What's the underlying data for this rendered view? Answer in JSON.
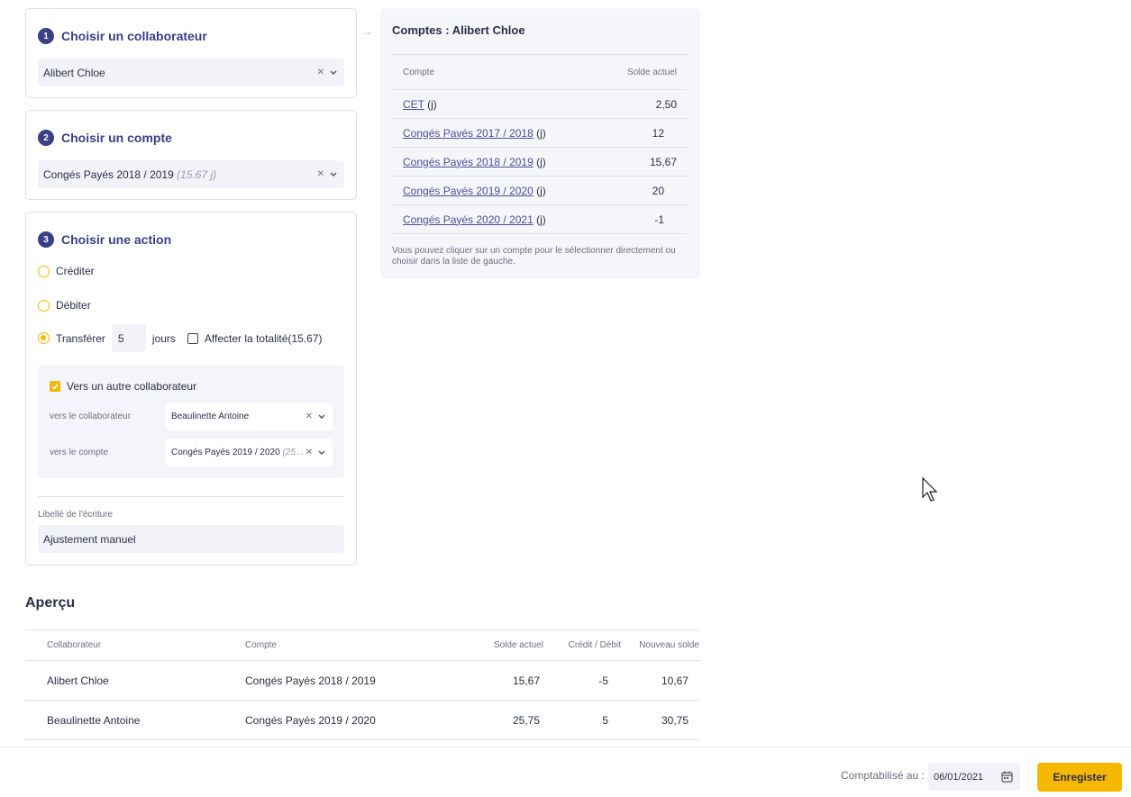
{
  "step1": {
    "number": "1",
    "title": "Choisir un collaborateur",
    "selected": "Alibert Chloe"
  },
  "step2": {
    "number": "2",
    "title": "Choisir un compte",
    "selected": "Congés Payés 2018 / 2019",
    "selected_extra": "(15.67 j)"
  },
  "step3": {
    "number": "3",
    "title": "Choisir une action",
    "options": {
      "credit": "Créditer",
      "debit": "Débiter",
      "transfer": "Transférer"
    },
    "selected_option": "transfer",
    "transfer_amount": "5",
    "unit": "jours",
    "affect_all_label": "Affecter la totalité(15.67)",
    "affect_all_checked": false,
    "other_collab_label": "Vers un autre collaborateur",
    "other_collab_checked": true,
    "to_collab_label": "vers le collaborateur",
    "to_collab_value": "Beaulinette Antoine",
    "to_account_label": "vers le compte",
    "to_account_value": "Congés Payés 2019 / 2020",
    "to_account_extra": "(25...",
    "entry_label": "Libellé de l'écriture",
    "entry_value": "Ajustement manuel"
  },
  "accounts_panel": {
    "title": "Comptes : Alibert Chloe",
    "col_account": "Compte",
    "col_balance": "Solde actuel",
    "unit_suffix": "(j)",
    "rows": [
      {
        "name": "CET",
        "balance": "2,50"
      },
      {
        "name": "Congés Payés 2017 / 2018",
        "balance": "12"
      },
      {
        "name": "Congés Payés 2018 / 2019",
        "balance": "15,67"
      },
      {
        "name": "Congés Payés 2019 / 2020",
        "balance": "20"
      },
      {
        "name": "Congés Payés 2020 / 2021",
        "balance": "-1"
      }
    ],
    "hint": "Vous pouvez cliquer sur un compte pour le sélectionner directement ou choisir dans la liste de gauche."
  },
  "preview": {
    "title": "Aperçu",
    "headers": [
      "Collaborateur",
      "Compte",
      "Solde actuel",
      "Crédit / Débit",
      "Nouveau solde"
    ],
    "rows": [
      [
        "Alibert Chloe",
        "Congés Payés 2018 / 2019",
        "15,67",
        "-5",
        "10,67"
      ],
      [
        "Beaulinette Antoine",
        "Congés Payés 2019 / 2020",
        "25,75",
        "5",
        "30,75"
      ]
    ]
  },
  "footer": {
    "date_label": "Comptabilisé au :",
    "date_value": "06/01/2021",
    "save_label": "Enregister"
  },
  "colors": {
    "accent": "#3b3f86",
    "primary_button": "#f5b700",
    "input_bg": "#f2f3f9"
  }
}
